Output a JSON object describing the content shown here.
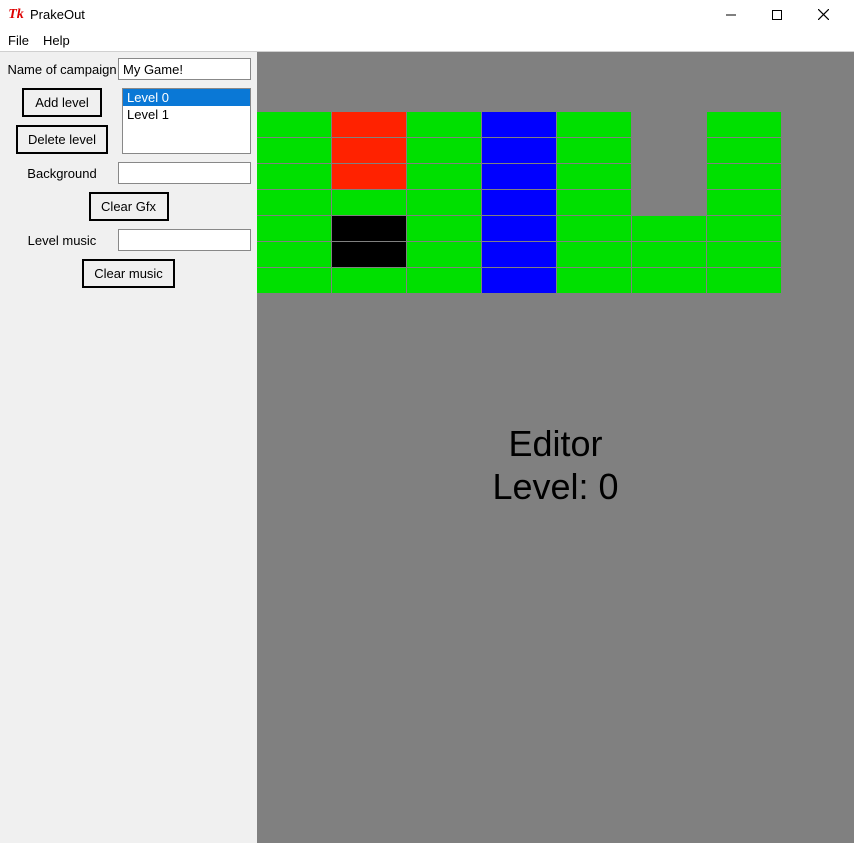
{
  "window": {
    "app_icon_glyph": "Tk",
    "title": "PrakeOut"
  },
  "menu": {
    "file": "File",
    "help": "Help"
  },
  "sidebar": {
    "campaign_label": "Name of campaign",
    "campaign_value": "My Game!",
    "add_level": "Add level",
    "delete_level": "Delete level",
    "background_label": "Background",
    "background_value": "",
    "clear_gfx": "Clear Gfx",
    "music_label": "Level music",
    "music_value": "",
    "clear_music": "Clear music",
    "levels": [
      {
        "label": "Level 0",
        "selected": true
      },
      {
        "label": "Level 1",
        "selected": false
      }
    ]
  },
  "editor": {
    "line1": "Editor",
    "line2": "Level: 0",
    "grid": [
      [
        "green",
        "red",
        "green",
        "blue",
        "green",
        "gray",
        "green",
        "gray"
      ],
      [
        "green",
        "red",
        "green",
        "blue",
        "green",
        "gray",
        "green",
        "gray"
      ],
      [
        "green",
        "red",
        "green",
        "blue",
        "green",
        "gray",
        "green",
        "gray"
      ],
      [
        "green",
        "green",
        "green",
        "blue",
        "green",
        "gray",
        "green",
        "gray"
      ],
      [
        "green",
        "black",
        "green",
        "blue",
        "green",
        "green",
        "green",
        "gray"
      ],
      [
        "green",
        "black",
        "green",
        "blue",
        "green",
        "green",
        "green",
        "gray"
      ],
      [
        "green",
        "green",
        "green",
        "blue",
        "green",
        "green",
        "green",
        "gray"
      ]
    ]
  }
}
